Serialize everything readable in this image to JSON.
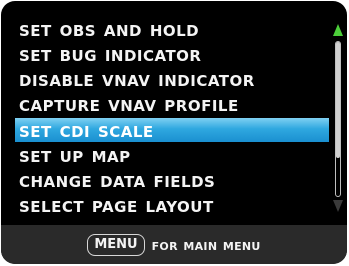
{
  "menu": {
    "items": [
      {
        "label": "Set OBS and Hold",
        "selected": false
      },
      {
        "label": "Set Bug Indicator",
        "selected": false
      },
      {
        "label": "Disable VNAV Indicator",
        "selected": false
      },
      {
        "label": "Capture VNAV Profile",
        "selected": false
      },
      {
        "label": "Set CDI Scale",
        "selected": true
      },
      {
        "label": "Set Up Map",
        "selected": false
      },
      {
        "label": "Change Data Fields",
        "selected": false
      },
      {
        "label": "Select Page Layout",
        "selected": false
      }
    ]
  },
  "scrollbar": {
    "up_arrow_color": "#4ccf3a",
    "down_arrow_color": "#3a3a3a"
  },
  "footer": {
    "key_label": "MENU",
    "text": "for Main Menu"
  },
  "colors": {
    "background": "#000000",
    "text": "#f4f4f4",
    "highlight": "#1a8fd0",
    "footer_background": "#2a2a2a"
  }
}
